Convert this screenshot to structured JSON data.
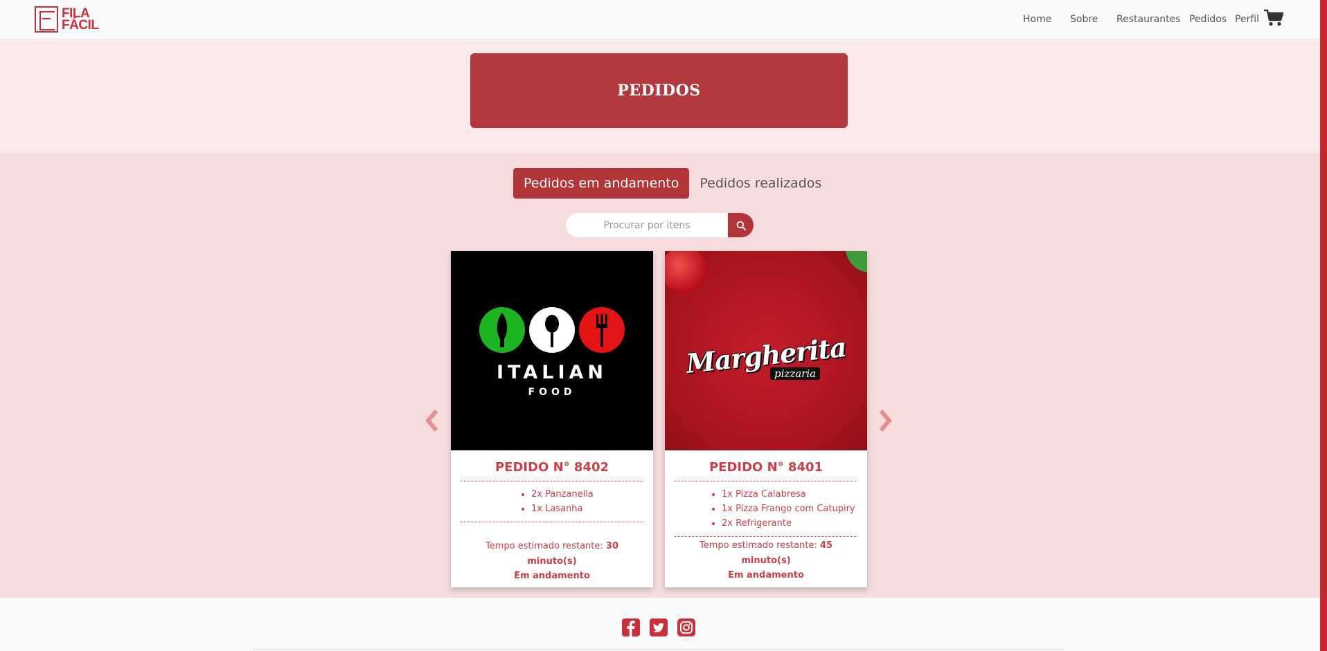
{
  "brand": {
    "line1": "FILA",
    "line2": "FÁCIL"
  },
  "nav": {
    "home": "Home",
    "sobre": "Sobre",
    "restaurantes": "Restaurantes",
    "pedidos": "Pedidos",
    "perfil": "Perfil"
  },
  "page_title": "PEDIDOS",
  "tabs": {
    "active": "Pedidos em andamento",
    "inactive": "Pedidos realizados"
  },
  "search": {
    "placeholder": "Procurar por itens"
  },
  "orders": [
    {
      "title": "PEDIDO N° 8402",
      "image_brand": "ITALIAN",
      "image_sub": "FOOD",
      "items": [
        "2x Panzanella",
        "1x Lasanha"
      ],
      "eta_label": "Tempo estimado restante:",
      "eta_value": "30 minuto(s)",
      "status": "Em andamento"
    },
    {
      "title": "PEDIDO N° 8401",
      "image_brand": "Margherita",
      "image_sub": "pizzaria",
      "items": [
        "1x Pizza Calabresa",
        "1x Pizza Frango com Catupiry",
        "2x Refrigerante"
      ],
      "eta_label": "Tempo estimado restante:",
      "eta_value": "45 minuto(s)",
      "status": "Em andamento"
    }
  ],
  "colors": {
    "brand_red": "#c8313b",
    "title_box": "#b23a3f",
    "header_band": "#fbeaea",
    "main_band": "#f6dcdc",
    "card_text": "#c9404a"
  },
  "footer": {
    "icons": [
      "facebook-icon",
      "twitter-icon",
      "instagram-icon"
    ]
  }
}
